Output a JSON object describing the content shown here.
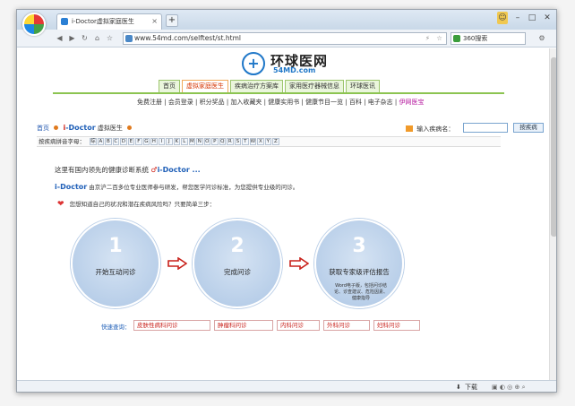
{
  "browser": {
    "tab_title": "i-Doctor虚拟家庭医生",
    "tab_close": "×",
    "new_tab": "+",
    "url": "www.54md.com/selftest/st.html",
    "search_text": "360搜索",
    "nav_icons": [
      "back-icon",
      "forward-icon",
      "refresh-icon",
      "home-icon",
      "favorite-icon",
      "history-icon"
    ],
    "status_right": "下载"
  },
  "site": {
    "name": "环球医网",
    "domain": "54MD.com",
    "main_nav": [
      "首页",
      "虚拟家庭医生",
      "疾病治疗方案库",
      "家用医疗器械信息",
      "环球医讯"
    ],
    "main_nav_active": 1,
    "sub_nav": [
      "免费注册",
      "会员登录",
      "积分奖品",
      "加入收藏夹",
      "健康实用书",
      "健康节目一览",
      "百科",
      "电子杂志",
      "伊网医宝"
    ],
    "accent": "#8cc451",
    "highlight": "#d53300"
  },
  "breadcrumb": {
    "home": "首页",
    "brand_i": "i",
    "brand_rest": "-Doctor",
    "section": "虚拟医生"
  },
  "disease_search": {
    "label": "输入疾病名：",
    "value": "",
    "button": "按疾病"
  },
  "pinyin": {
    "label": "按疾病拼音字母：",
    "letters": [
      "综",
      "A",
      "B",
      "C",
      "D",
      "E",
      "F",
      "G",
      "H",
      "I",
      "J",
      "K",
      "L",
      "M",
      "N",
      "O",
      "P",
      "Q",
      "R",
      "S",
      "T",
      "W",
      "X",
      "Y",
      "Z"
    ]
  },
  "intro": {
    "line1": "这里有国内领先的健康诊断系统",
    "line1_brand": "i-Doctor ...",
    "line2_brand": "i-Doctor",
    "line2": "由京沪二百多位专业医师参与研发，帮您医学问诊标准，为您提供专业级的问诊。",
    "line3": "您想知道自己的状况和潜在疾病风险吗？只要简单三步："
  },
  "steps": [
    {
      "num": "1",
      "label": "开始互动问诊",
      "sub": ""
    },
    {
      "num": "2",
      "label": "完成问诊",
      "sub": ""
    },
    {
      "num": "3",
      "label": "获取专家级评估报告",
      "sub": "Word电子版，包括问诊结论、诊查建议、危险因素、健康指导"
    }
  ],
  "quick": {
    "label": "快速查询：",
    "items": [
      "皮肤性病科问诊",
      "肿瘤科问诊",
      "内科问诊",
      "外科问诊",
      "妇科问诊"
    ]
  }
}
